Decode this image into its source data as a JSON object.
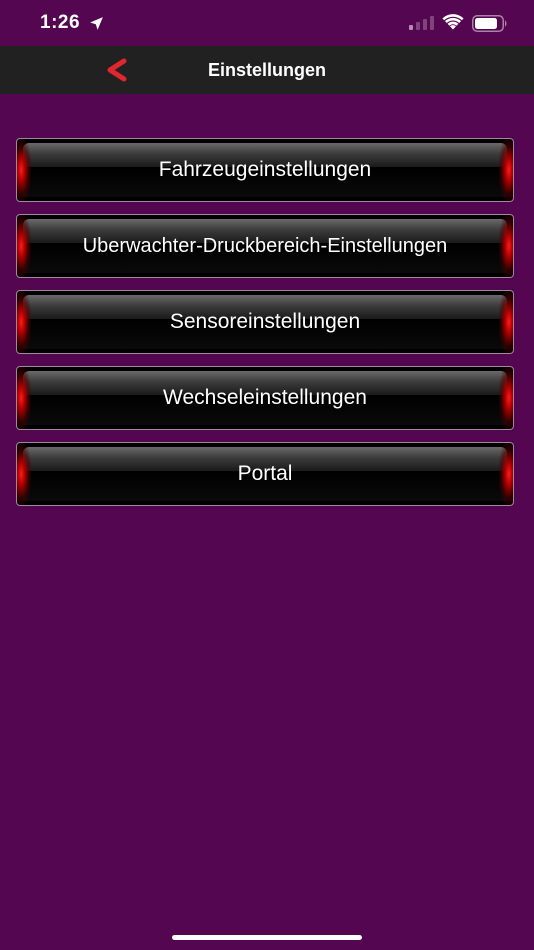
{
  "status_bar": {
    "time": "1:26",
    "icons": [
      "location-arrow-icon",
      "cellular-signal-icon",
      "wifi-icon",
      "battery-icon"
    ]
  },
  "nav": {
    "title": "Einstellungen",
    "back_icon": "chevron-left-icon"
  },
  "menu": {
    "items": [
      {
        "label": "Fahrzeugeinstellungen"
      },
      {
        "label": "Uberwachter-Druckbereich-Einstellungen"
      },
      {
        "label": "Sensoreinstellungen"
      },
      {
        "label": "Wechseleinstellungen"
      },
      {
        "label": "Portal"
      }
    ]
  },
  "colors": {
    "background": "#540650",
    "nav_bar": "#212121",
    "back_chevron": "#e0262f",
    "button_glow": "#ff1a1a"
  }
}
